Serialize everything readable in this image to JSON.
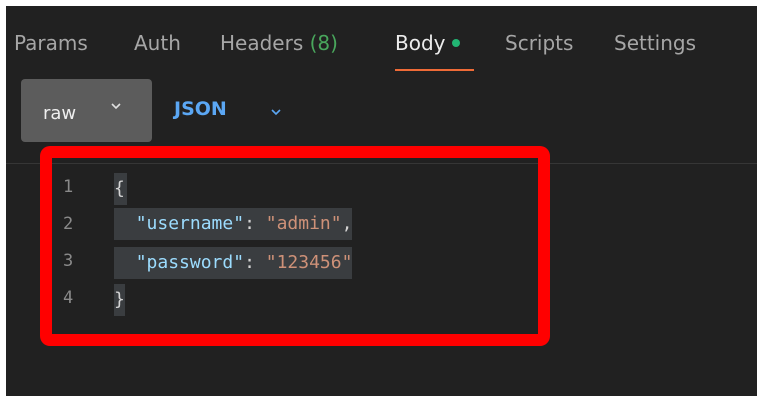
{
  "tabs": [
    {
      "label": "Params"
    },
    {
      "label": "Auth"
    },
    {
      "label": "Headers",
      "count": "(8)"
    },
    {
      "label": "Body"
    },
    {
      "label": "Scripts"
    },
    {
      "label": "Settings"
    }
  ],
  "active_tab": "Body",
  "body_mode": {
    "raw": "raw",
    "format": "JSON"
  },
  "editor": {
    "line_numbers": [
      "1",
      "2",
      "3",
      "4"
    ],
    "lines": {
      "open_brace": "{",
      "username_key": "\"username\"",
      "username_value": "\"admin\"",
      "password_key": "\"password\"",
      "password_value": "\"123456\"",
      "close_brace": "}"
    }
  },
  "colors": {
    "accent": "#ef6b37",
    "status_dot": "#22b573",
    "highlight": "#ff0000",
    "json_label": "#5ba7f4"
  }
}
